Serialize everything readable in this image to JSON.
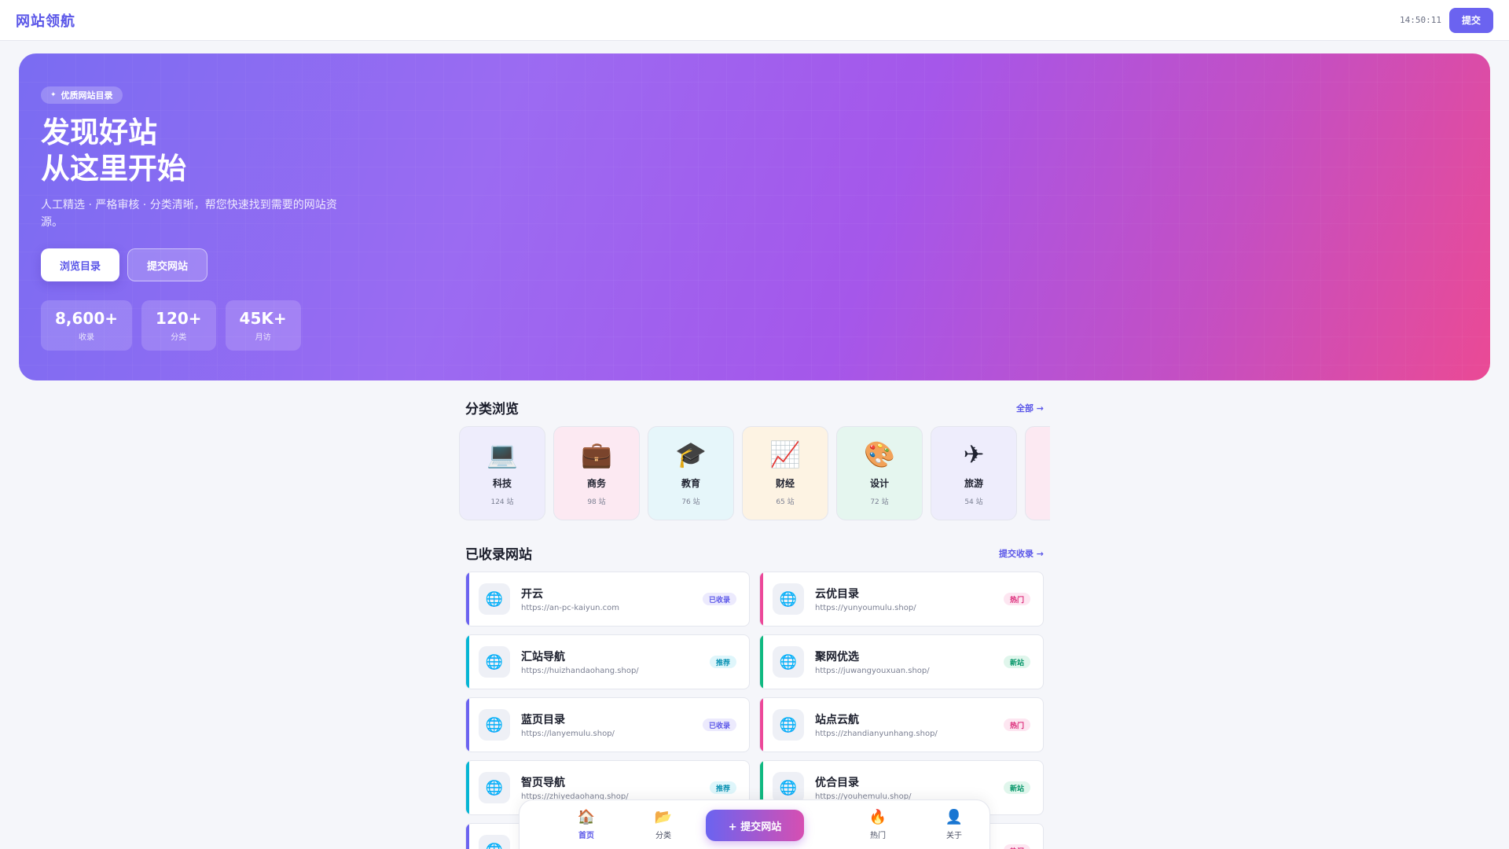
{
  "header": {
    "brand": "网站领航",
    "time": "14:50:11",
    "submit_label": "提交"
  },
  "hero": {
    "badge_icon": "✦",
    "badge": "优质网站目录",
    "title_line1": "发现好站",
    "title_line2": "从这里开始",
    "description": "人工精选 · 严格审核 · 分类清晰，帮您快速找到需要的网站资源。",
    "browse_label": "浏览目录",
    "submit_label": "提交网站",
    "stats": [
      {
        "value": "8,600+",
        "label": "收录"
      },
      {
        "value": "120+",
        "label": "分类"
      },
      {
        "value": "45K+",
        "label": "月访"
      }
    ]
  },
  "categories": {
    "title": "分类浏览",
    "link": "全部 →",
    "items": [
      {
        "icon": "💻",
        "icon_name": "laptop-icon",
        "name": "科技",
        "count": "124 站",
        "bg": "#eeedfc"
      },
      {
        "icon": "💼",
        "icon_name": "briefcase-icon",
        "name": "商务",
        "count": "98 站",
        "bg": "#fce9f2"
      },
      {
        "icon": "🎓",
        "icon_name": "graduation-cap-icon",
        "name": "教育",
        "count": "76 站",
        "bg": "#e6f6fa"
      },
      {
        "icon": "📈",
        "icon_name": "chart-up-icon",
        "name": "财经",
        "count": "65 站",
        "bg": "#fdf3e3"
      },
      {
        "icon": "🎨",
        "icon_name": "palette-icon",
        "name": "设计",
        "count": "72 站",
        "bg": "#e5f6ef"
      },
      {
        "icon": "✈",
        "icon_name": "airplane-icon",
        "name": "旅游",
        "count": "54 站",
        "bg": "#eeedfc"
      },
      {
        "icon": "",
        "icon_name": "",
        "name": "",
        "count": "",
        "bg": "#fce9f2"
      }
    ]
  },
  "sites": {
    "title": "已收录网站",
    "link": "提交收录 →",
    "items": [
      {
        "name": "开云",
        "url": "https://an-pc-kaiyun.com",
        "tag": "已收录",
        "accent": "#6b63f0",
        "tag_bg": "#eceafd",
        "tag_color": "#5b57e8"
      },
      {
        "name": "云优目录",
        "url": "https://yunyoumulu.shop/",
        "tag": "热门",
        "accent": "#ec4899",
        "tag_bg": "#fde6f1",
        "tag_color": "#db2777"
      },
      {
        "name": "汇站导航",
        "url": "https://huizhandaohang.shop/",
        "tag": "推荐",
        "accent": "#06b6d4",
        "tag_bg": "#dff6fb",
        "tag_color": "#0891b2"
      },
      {
        "name": "聚网优选",
        "url": "https://juwangyouxuan.shop/",
        "tag": "新站",
        "accent": "#10b981",
        "tag_bg": "#e0f6ec",
        "tag_color": "#059669"
      },
      {
        "name": "蓝页目录",
        "url": "https://lanyemulu.shop/",
        "tag": "已收录",
        "accent": "#6b63f0",
        "tag_bg": "#eceafd",
        "tag_color": "#5b57e8"
      },
      {
        "name": "站点云航",
        "url": "https://zhandianyunhang.shop/",
        "tag": "热门",
        "accent": "#ec4899",
        "tag_bg": "#fde6f1",
        "tag_color": "#db2777"
      },
      {
        "name": "智页导航",
        "url": "https://zhiyedaohang.shop/",
        "tag": "推荐",
        "accent": "#06b6d4",
        "tag_bg": "#dff6fb",
        "tag_color": "#0891b2"
      },
      {
        "name": "优合目录",
        "url": "https://youhemulu.shop/",
        "tag": "新站",
        "accent": "#10b981",
        "tag_bg": "#e0f6ec",
        "tag_color": "#059669"
      },
      {
        "name": "",
        "url": "",
        "tag": "",
        "accent": "#6b63f0",
        "tag_bg": "#eceafd",
        "tag_color": "#5b57e8"
      },
      {
        "name": "",
        "url": "",
        "tag": "热门",
        "accent": "#ec4899",
        "tag_bg": "#fde6f1",
        "tag_color": "#db2777"
      }
    ]
  },
  "bottom_nav": {
    "items": [
      {
        "icon": "🏠",
        "icon_name": "home-icon",
        "label": "首页",
        "active": true
      },
      {
        "icon": "📂",
        "icon_name": "folder-icon",
        "label": "分类",
        "active": false
      },
      {
        "icon": "🔥",
        "icon_name": "fire-icon",
        "label": "热门",
        "active": false
      },
      {
        "icon": "👤",
        "icon_name": "user-icon",
        "label": "关于",
        "active": false
      }
    ],
    "submit_label": "+ 提交网站"
  },
  "colors": {
    "brand": "#5b57e8",
    "hero_start": "#7a6cf2",
    "hero_end": "#ea4a95"
  }
}
